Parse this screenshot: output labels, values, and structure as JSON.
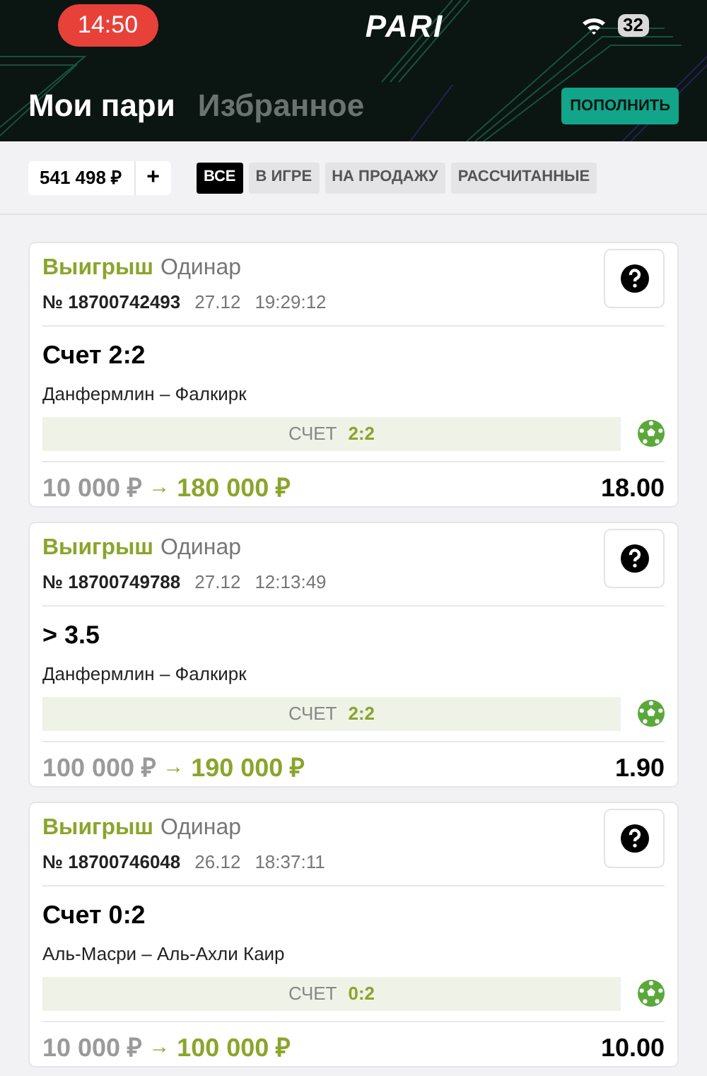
{
  "status_bar": {
    "time": "14:50",
    "logo": "PARI",
    "battery": "32"
  },
  "header": {
    "tabs": [
      {
        "label": "Мои пари",
        "selected": true
      },
      {
        "label": "Избранное",
        "selected": false
      }
    ],
    "top_up_button": "ПОПОЛНИТЬ"
  },
  "balance": {
    "amount": "541 498 ₽",
    "add": "+"
  },
  "filters": [
    {
      "label": "ВСЕ",
      "selected": true
    },
    {
      "label": "В ИГРЕ",
      "selected": false
    },
    {
      "label": "НА ПРОДАЖУ",
      "selected": false
    },
    {
      "label": "РАССЧИТАННЫЕ",
      "selected": false
    }
  ],
  "bets": [
    {
      "result": "Выигрыш",
      "type": "Одинар",
      "number": "№ 18700742493",
      "date": "27.12",
      "time": "19:29:12",
      "outcome": "Счет 2:2",
      "match": "Данфермлин – Фалкирк",
      "score_label": "СЧЕТ",
      "score": "2:2",
      "stake": "10 000 ₽",
      "arrow": "→",
      "payout": "180 000 ₽",
      "odds": "18.00"
    },
    {
      "result": "Выигрыш",
      "type": "Одинар",
      "number": "№ 18700749788",
      "date": "27.12",
      "time": "12:13:49",
      "outcome": "> 3.5",
      "match": "Данфермлин – Фалкирк",
      "score_label": "СЧЕТ",
      "score": "2:2",
      "stake": "100 000 ₽",
      "arrow": "→",
      "payout": "190 000 ₽",
      "odds": "1.90"
    },
    {
      "result": "Выигрыш",
      "type": "Одинар",
      "number": "№ 18700746048",
      "date": "26.12",
      "time": "18:37:11",
      "outcome": "Счет 0:2",
      "match": "Аль-Масри – Аль-Ахли Каир",
      "score_label": "СЧЕТ",
      "score": "0:2",
      "stake": "10 000 ₽",
      "arrow": "→",
      "payout": "100 000 ₽",
      "odds": "10.00"
    }
  ]
}
